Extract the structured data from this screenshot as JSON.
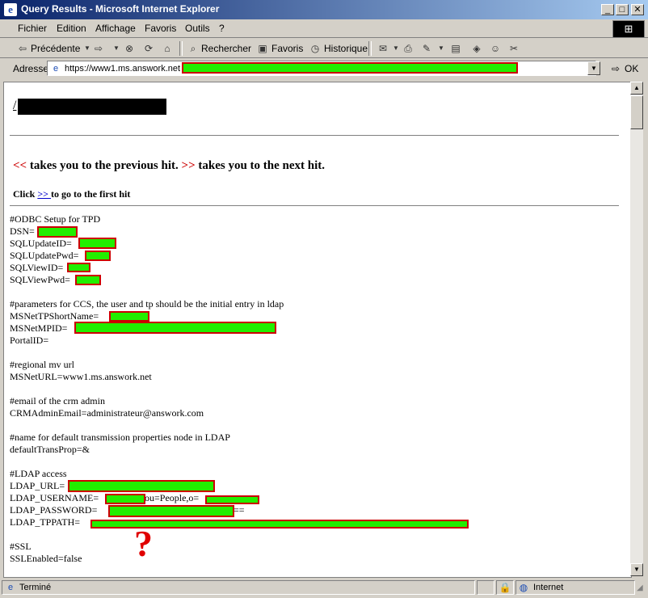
{
  "window": {
    "title": "Query Results - Microsoft Internet Explorer",
    "min": "_",
    "max": "□",
    "close": "✕"
  },
  "menu": {
    "items": [
      "Fichier",
      "Edition",
      "Affichage",
      "Favoris",
      "Outils",
      "?"
    ]
  },
  "toolbar": {
    "back": "Précédente",
    "search": "Rechercher",
    "favorites": "Favoris",
    "history": "Historique"
  },
  "address": {
    "label": "Adresse",
    "url": "https://www1.ms.answork.net",
    "go": "OK"
  },
  "content": {
    "breadcrumb": "/",
    "nav_prev_sym": "<<",
    "nav_prev_text": " takes you to the previous hit. ",
    "nav_next_sym": ">>",
    "nav_next_text": " takes you to the next hit.",
    "click_pre": "Click ",
    "click_link": ">> ",
    "click_post": "to go to the first hit",
    "lines": [
      "#ODBC Setup for TPD",
      "DSN=",
      "SQLUpdateID=",
      "SQLUpdatePwd=",
      "SQLViewID=",
      "SQLViewPwd=",
      "",
      "#parameters for CCS, the user and tp should be the initial entry in ldap",
      "MSNetTPShortName=",
      "MSNetMPID=",
      "PortalID=",
      "",
      "#regional mv url",
      "MSNetURL=www1.ms.answork.net",
      "",
      "#email of the crm admin",
      "CRMAdminEmail=administrateur@answork.com",
      "",
      "#name for default transmission properties node in LDAP",
      "defaultTransProp=&",
      "",
      "#LDAP access",
      "LDAP_URL=",
      "LDAP_USERNAME=",
      "LDAP_PASSWORD=",
      "LDAP_TPPATH=",
      "",
      "#SSL",
      "SSLEnabled=false"
    ],
    "username_mid": "ou=People,o=",
    "password_tail": "==",
    "question_mark": "?"
  },
  "status": {
    "text": "Terminé",
    "zone": "Internet"
  },
  "colors": {
    "redaction_fill": "#22ee00",
    "redaction_border": "#cc0000",
    "nav_symbol": "#cc0000"
  }
}
